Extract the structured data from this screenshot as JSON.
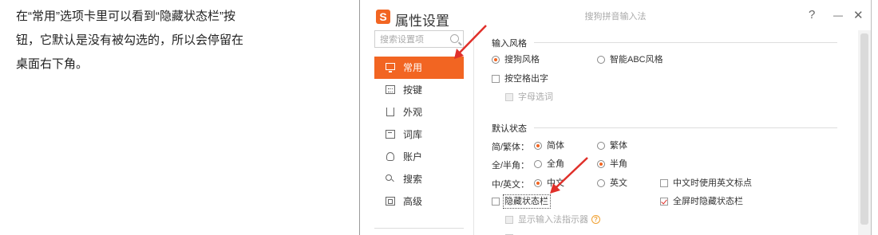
{
  "article": {
    "lines": [
      "在“常用”选项卡里可以看到“隐藏状态栏”按",
      "钮，它默认是没有被勾选的，所以会停留在",
      "桌面右下角。"
    ]
  },
  "window": {
    "logo": "S",
    "title": "属性设置",
    "subtitle": "搜狗拼音输入法",
    "help": "?",
    "minimize": "—",
    "close": "✕"
  },
  "sidebar": {
    "search_placeholder": "搜索设置项",
    "items": [
      {
        "label": "常用",
        "icon": "monitor-icon",
        "active": true
      },
      {
        "label": "按键",
        "icon": "keyboard-icon"
      },
      {
        "label": "外观",
        "icon": "shirt-icon"
      },
      {
        "label": "词库",
        "icon": "book-icon"
      },
      {
        "label": "账户",
        "icon": "user-icon"
      },
      {
        "label": "搜索",
        "icon": "search-icon"
      },
      {
        "label": "高级",
        "icon": "advanced-icon"
      }
    ]
  },
  "input_style": {
    "title": "输入风格",
    "option_sogou": "搜狗风格",
    "option_abc": "智能ABC风格",
    "space_output": "按空格出字",
    "letter_select": "字母选词"
  },
  "default_state": {
    "title": "默认状态",
    "simp_trad_label": "简/繁体：",
    "simplified": "简体",
    "traditional": "繁体",
    "width_label": "全/半角：",
    "full_width": "全角",
    "half_width": "半角",
    "lang_label": "中/英文：",
    "chinese": "中文",
    "english": "英文",
    "english_punct_in_chinese": "中文时使用英文标点",
    "hide_status_bar": "隐藏状态栏",
    "fullscreen_hide_status_bar": "全屏时隐藏状态栏",
    "show_input_indicator": "显示输入法指示器",
    "help_mark": "?"
  },
  "colors": {
    "accent": "#f26522",
    "arrow": "#e0302a"
  }
}
